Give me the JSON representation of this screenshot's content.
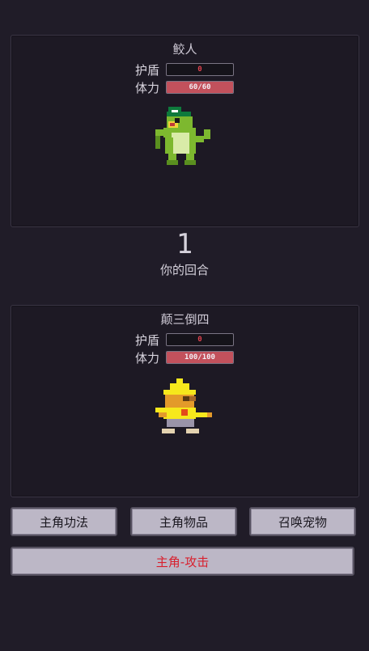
{
  "enemy": {
    "name": "鲛人",
    "shield_label": "护盾",
    "shield_value": "0",
    "hp_label": "体力",
    "hp_text": "60/60",
    "hp_fraction": 1.0
  },
  "turn": {
    "number": "1",
    "label": "你的回合"
  },
  "hero": {
    "name": "颠三倒四",
    "shield_label": "护盾",
    "shield_value": "0",
    "hp_label": "体力",
    "hp_text": "100/100",
    "hp_fraction": 1.0
  },
  "actions": {
    "skills": "主角功法",
    "items": "主角物品",
    "summon": "召唤宠物",
    "attack": "主角-攻击"
  },
  "colors": {
    "background": "#201c28",
    "hp_fill": "#c2515c",
    "attack_text": "#d8202e",
    "button_bg": "#bcb7c6"
  },
  "icons": {
    "enemy_sprite": "shark-man-pixel-sprite",
    "hero_sprite": "yellow-hooded-hero-pixel-sprite"
  }
}
